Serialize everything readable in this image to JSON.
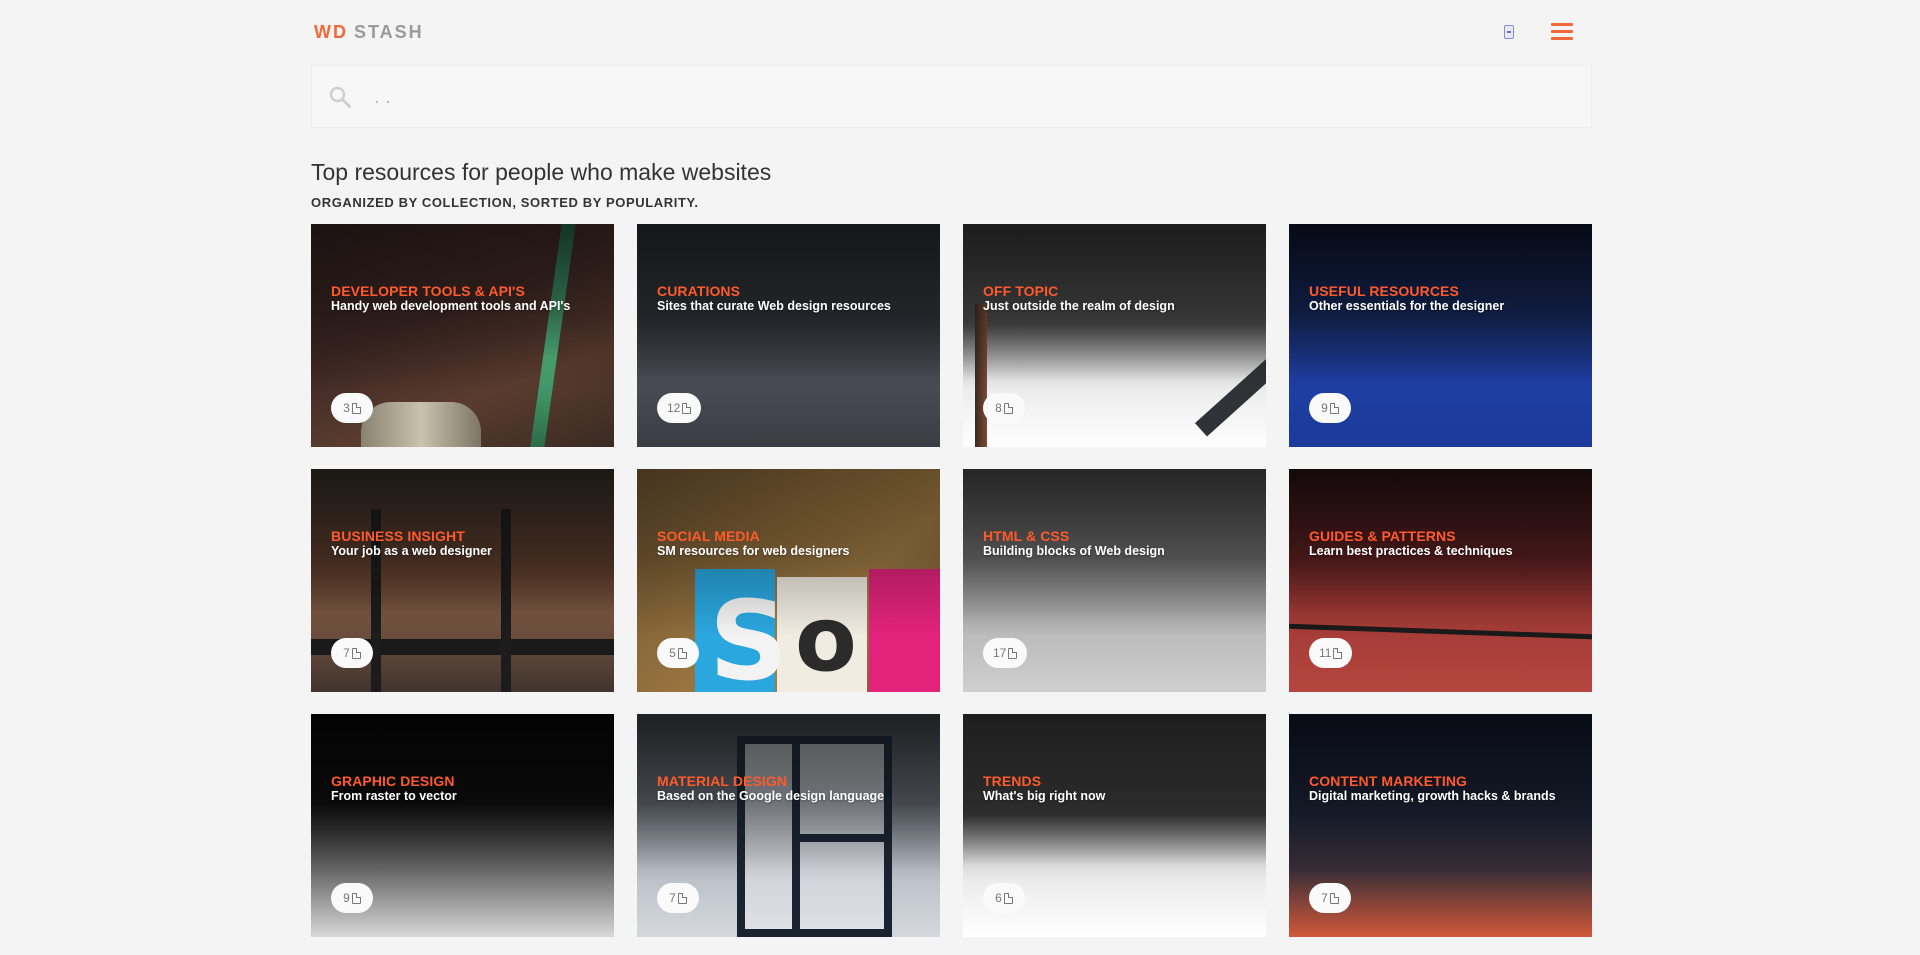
{
  "header": {
    "logo_wd": "WD",
    "logo_stash": "STASH"
  },
  "search": {
    "placeholder": ". ."
  },
  "page": {
    "title": "Top resources for people who make websites",
    "subtitle": "ORGANIZED BY COLLECTION, SORTED BY POPULARITY."
  },
  "collections": [
    {
      "title": "DEVELOPER TOOLS & API'S",
      "description": "Handy web development tools and API's",
      "count": "3"
    },
    {
      "title": "CURATIONS",
      "description": "Sites that curate Web design resources",
      "count": "12"
    },
    {
      "title": "OFF TOPIC",
      "description": "Just outside the realm of design",
      "count": "8"
    },
    {
      "title": "USEFUL RESOURCES",
      "description": "Other essentials for the designer",
      "count": "9"
    },
    {
      "title": "BUSINESS INSIGHT",
      "description": "Your job as a web designer",
      "count": "7"
    },
    {
      "title": "SOCIAL MEDIA",
      "description": "SM resources for web designers",
      "count": "5"
    },
    {
      "title": "HTML & CSS",
      "description": "Building blocks of Web design",
      "count": "17"
    },
    {
      "title": "GUIDES & PATTERNS",
      "description": "Learn best practices & techniques",
      "count": "11"
    },
    {
      "title": "GRAPHIC DESIGN",
      "description": "From raster to vector",
      "count": "9"
    },
    {
      "title": "MATERIAL DESIGN",
      "description": "Based on the Google design language",
      "count": "7"
    },
    {
      "title": "TRENDS",
      "description": "What's big right now",
      "count": "6"
    },
    {
      "title": "CONTENT MARKETING",
      "description": "Digital marketing, growth hacks & brands",
      "count": "7"
    }
  ],
  "colors": {
    "accent": "#f2683b",
    "card_title": "#ff5a2c",
    "background": "#f4f4f4"
  },
  "icons": {
    "menu": "hamburger-menu-icon",
    "search": "search-icon",
    "count": "document-icon"
  }
}
